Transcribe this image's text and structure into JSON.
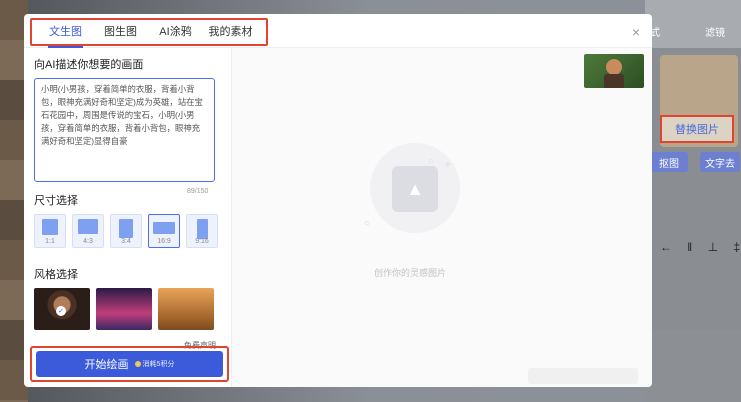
{
  "background": {
    "right_tab_1": "式",
    "right_tab_2": "滤镜",
    "replace_image_label": "替换图片",
    "btn_image": "抠图",
    "btn_text": "文字去",
    "align_icons": [
      "←",
      "‖",
      "⊥",
      "‡"
    ]
  },
  "modal": {
    "tabs": [
      {
        "label": "文生图",
        "active": true
      },
      {
        "label": "图生图",
        "active": false
      },
      {
        "label": "AI涂鸦",
        "active": false
      },
      {
        "label": "我的素材",
        "active": false
      }
    ],
    "close_icon": "×",
    "prompt_title": "向AI描述你想要的画面",
    "prompt_text": "小明(小男孩，穿着简单的衣服，背着小背包，眼神充满好奇和坚定)成为英雄，站在宝石花园中，周围是传说的宝石，小明(小男孩，穿着简单的衣服，背着小背包，眼神充满好奇和坚定)显得自豪",
    "prompt_counter": "89/150",
    "size_title": "尺寸选择",
    "sizes": [
      {
        "label": "1:1",
        "active": false
      },
      {
        "label": "4:3",
        "active": false
      },
      {
        "label": "3:4",
        "active": false
      },
      {
        "label": "16:9",
        "active": true
      },
      {
        "label": "9:16",
        "active": false
      }
    ],
    "style_title": "风格选择",
    "free_link": "免费声明",
    "draw_button": "开始绘画",
    "draw_cost": "消耗5积分",
    "empty_text": "创作你的灵感图片"
  },
  "colors": {
    "accent": "#3b5bdb",
    "highlight": "#e2452f"
  }
}
